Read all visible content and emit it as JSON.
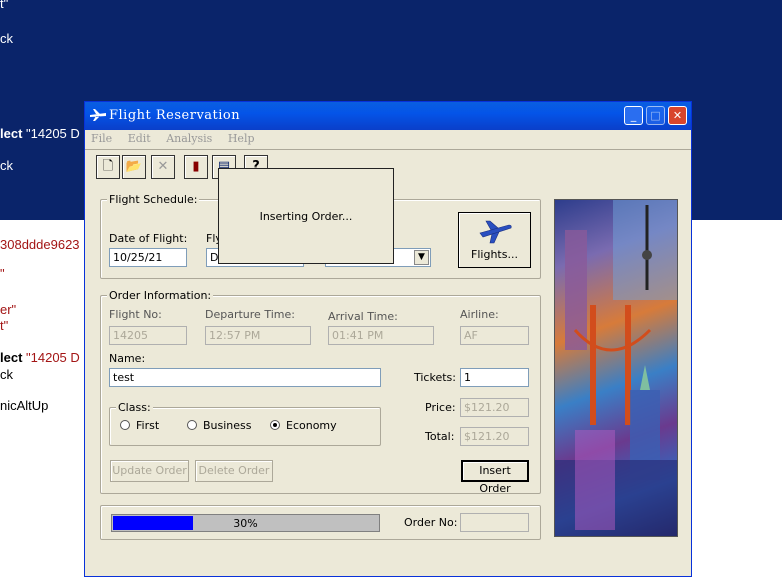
{
  "background": {
    "lines": [
      {
        "text": "t\"",
        "x_class": "w"
      },
      {
        "text": "ck",
        "x_class": "w"
      },
      {
        "text": "lect",
        "tail": " \"14205  D",
        "x_class": "w"
      },
      {
        "text": "ck",
        "x_class": "w"
      },
      {
        "text": "308ddde9623",
        "x_class": "r"
      },
      {
        "text": "\"",
        "x_class": "r"
      },
      {
        "text": "er\"",
        "x_class": "r"
      },
      {
        "text": "t\"",
        "x_class": "r"
      },
      {
        "text": "lect",
        "tail": " \"14205  D",
        "x_class": "k"
      },
      {
        "text": "ck",
        "x_class": "k"
      },
      {
        "text": "nicAltUp",
        "x_class": "k"
      }
    ]
  },
  "window": {
    "title": "Flight Reservation",
    "menu": [
      "File",
      "Edit",
      "Analysis",
      "Help"
    ],
    "toolbar_icons": [
      "new-document-icon",
      "open-folder-icon",
      "delete-x-icon",
      "bar-chart-icon",
      "window-icon",
      "help-icon"
    ]
  },
  "schedule": {
    "legend": "Flight Schedule:",
    "date_label": "Date of Flight:",
    "date_value": "10/25/21",
    "fly_from_label_partial": "Fly",
    "fly_from_partial": "D",
    "flights_button": "Flights..."
  },
  "popup": {
    "message": "Inserting Order..."
  },
  "order": {
    "legend": "Order Information:",
    "flight_no_label": "Flight No:",
    "flight_no": "14205",
    "departure_label": "Departure Time:",
    "departure": "12:57 PM",
    "arrival_label": "Arrival Time:",
    "arrival": "01:41 PM",
    "airline_label": "Airline:",
    "airline": "AF",
    "name_label": "Name:",
    "name_value": "test",
    "tickets_label": "Tickets:",
    "tickets_value": "1",
    "class_legend": "Class:",
    "class_first": "First",
    "class_business": "Business",
    "class_economy": "Economy",
    "selected_class": "Economy",
    "price_label": "Price:",
    "price": "$121.20",
    "total_label": "Total:",
    "total": "$121.20",
    "update_button": "Update Order",
    "delete_button": "Delete Order",
    "insert_button": "Insert Order"
  },
  "status": {
    "progress_text": "30%",
    "progress_fraction": 0.3,
    "order_no_label": "Order No:",
    "order_no_value": ""
  }
}
